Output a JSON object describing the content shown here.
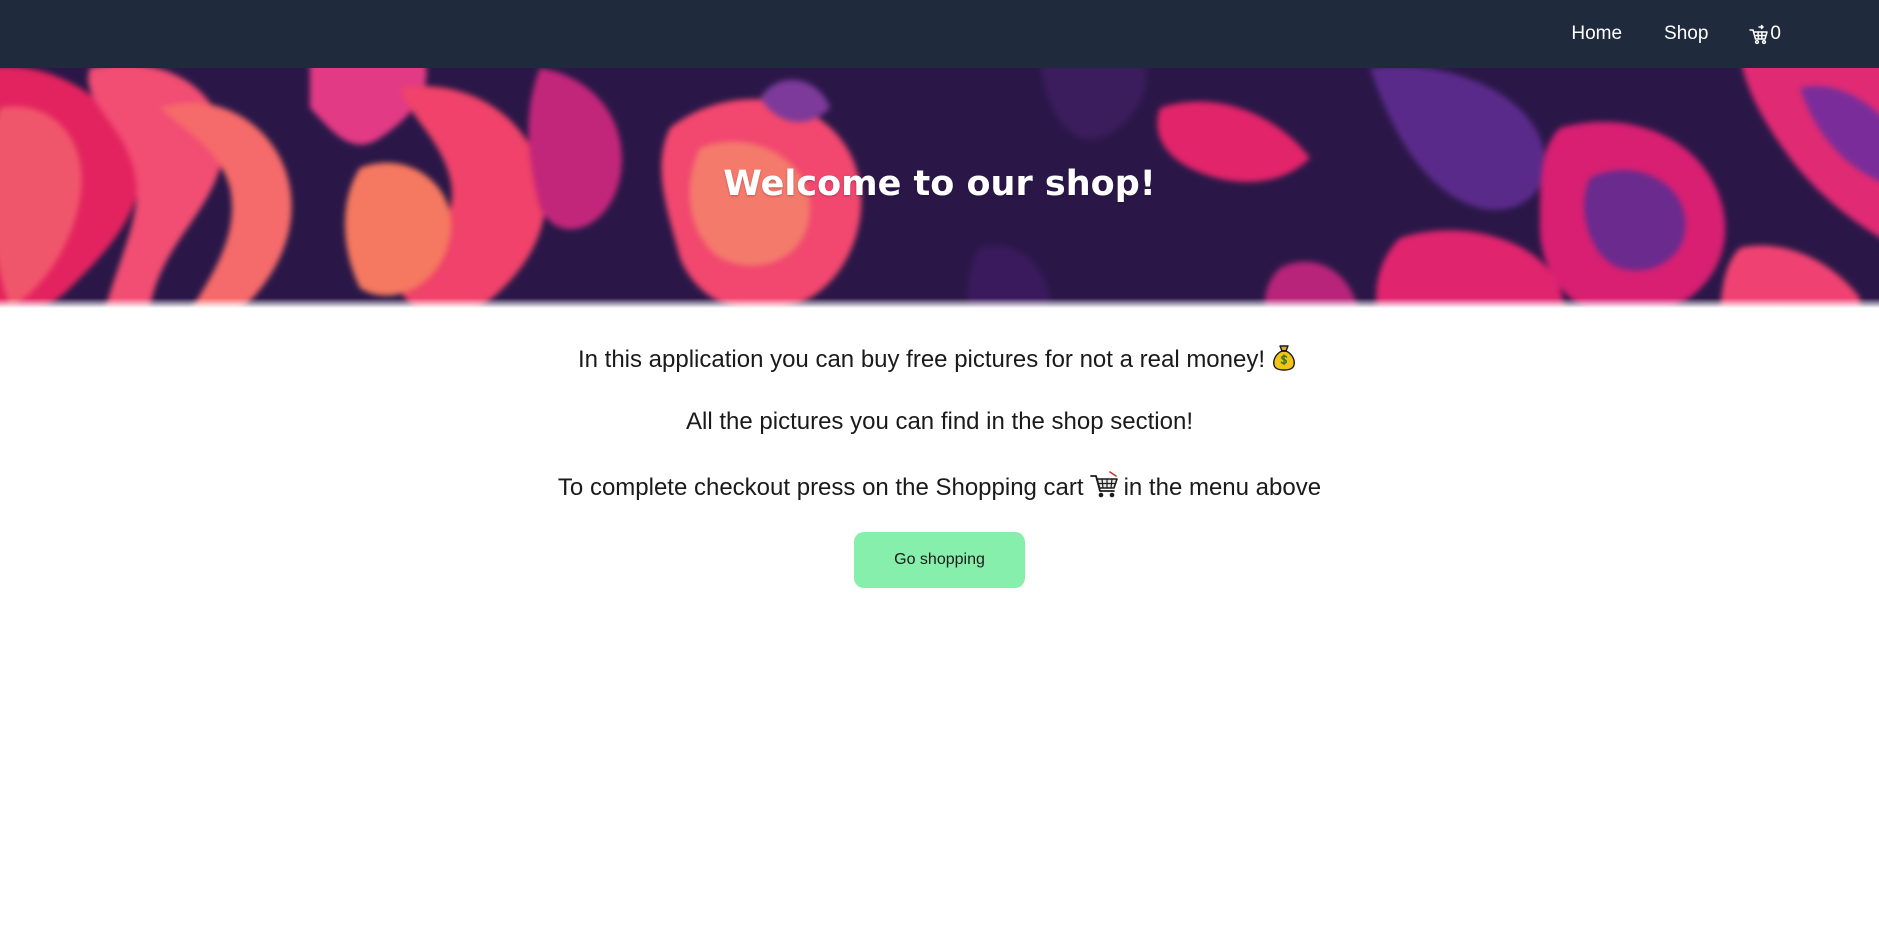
{
  "nav": {
    "home_label": "Home",
    "shop_label": "Shop",
    "cart_icon": "shopping-cart-icon",
    "cart_count": "0"
  },
  "hero": {
    "title": "Welcome to our shop!"
  },
  "content": {
    "line1": "In this application you can buy free pictures for not a real money!",
    "line1_icon": "money-bag-icon",
    "line2": "All the pictures you can find in the shop section!",
    "line3_before": "To complete checkout press on the Shopping cart",
    "line3_icon": "shopping-cart-icon",
    "line3_after": "in the menu above",
    "button_label": "Go shopping"
  },
  "colors": {
    "navbar": "#1f2a3c",
    "button": "#86efac",
    "hero_pink": "#ec2a6f",
    "hero_purple": "#2a1748"
  }
}
